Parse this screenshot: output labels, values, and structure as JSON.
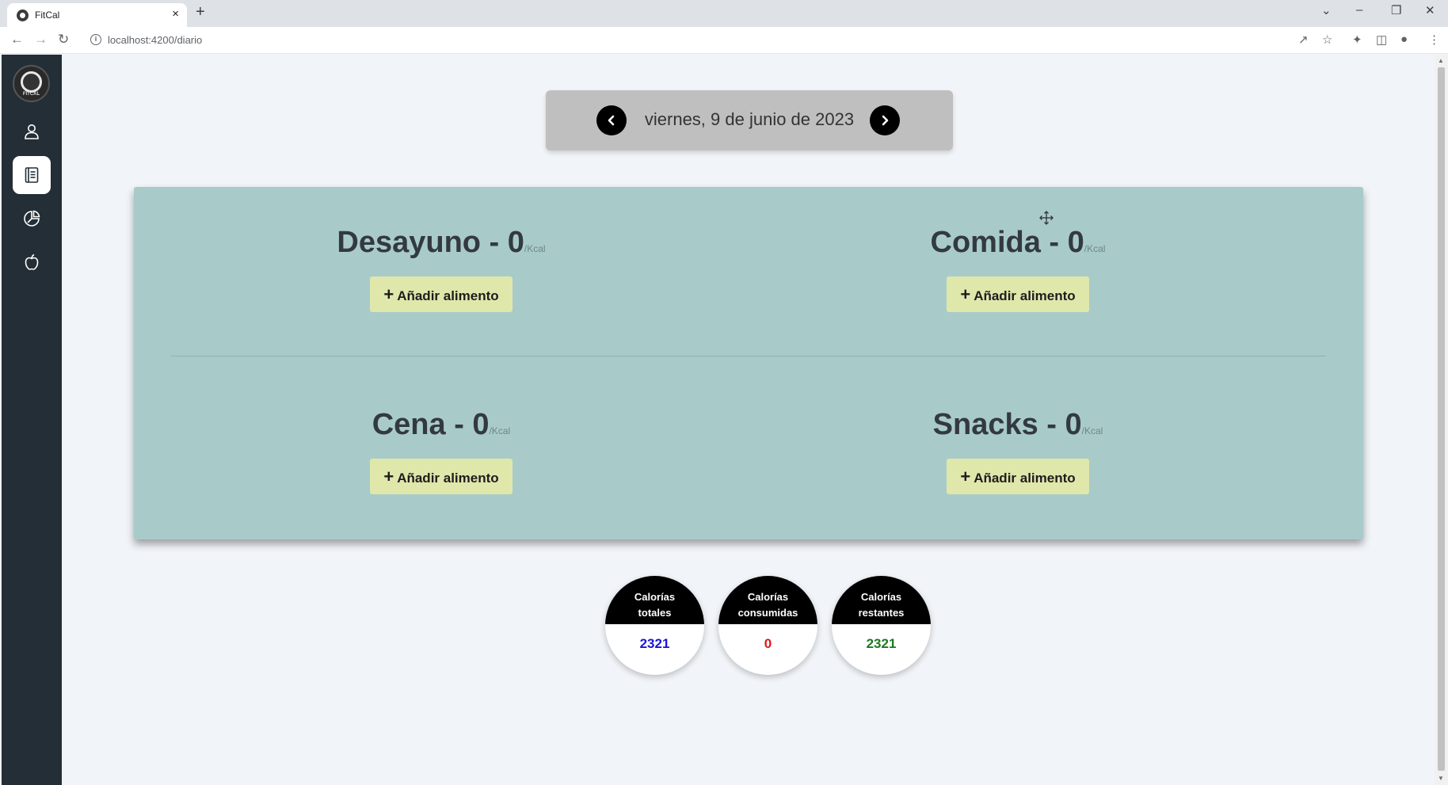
{
  "browser": {
    "tab_title": "FitCal",
    "tab_close": "×",
    "new_tab": "+",
    "url": "localhost:4200/diario",
    "controls": {
      "dropdown": "⌄",
      "minimize": "–",
      "restore": "❐",
      "close": "✕"
    }
  },
  "sidebar": {
    "logo_text": "FITCAL",
    "items": [
      {
        "name": "profile",
        "icon": "user-icon"
      },
      {
        "name": "diary",
        "icon": "book-icon",
        "active": true
      },
      {
        "name": "stats",
        "icon": "pie-chart-icon"
      },
      {
        "name": "foods",
        "icon": "apple-icon"
      }
    ]
  },
  "date_nav": {
    "date_text": "viernes, 9 de junio de 2023"
  },
  "meals": [
    {
      "title": "Desayuno - 0",
      "unit": "/Kcal",
      "button": "Añadir alimento"
    },
    {
      "title": "Comida - 0",
      "unit": "/Kcal",
      "button": "Añadir alimento"
    },
    {
      "title": "Cena - 0",
      "unit": "/Kcal",
      "button": "Añadir alimento"
    },
    {
      "title": "Snacks - 0",
      "unit": "/Kcal",
      "button": "Añadir alimento"
    }
  ],
  "add_symbol": "+",
  "stats": [
    {
      "label1": "Calorías",
      "label2": "totales",
      "value": "2321",
      "color": "#1a14d8"
    },
    {
      "label1": "Calorías",
      "label2": "consumidas",
      "value": "0",
      "color": "#e0141d"
    },
    {
      "label1": "Calorías",
      "label2": "restantes",
      "value": "2321",
      "color": "#1d7a1d"
    }
  ]
}
